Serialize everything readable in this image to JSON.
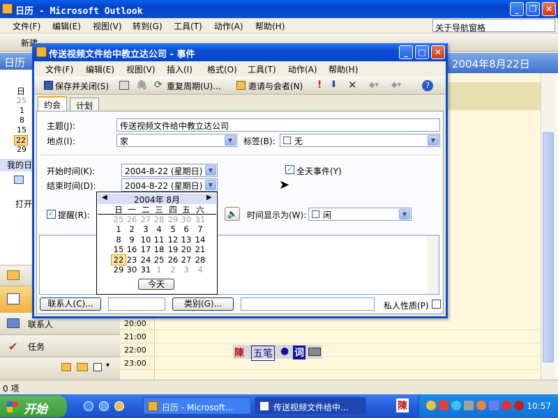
{
  "outlook": {
    "title": "日历 - Microsoft Outlook",
    "menu": [
      "文件(F)",
      "编辑(E)",
      "视图(V)",
      "转到(G)",
      "工具(T)",
      "动作(A)",
      "帮助(H)"
    ],
    "help_box": "关于导航窗格",
    "toolbar_partial": "新建",
    "nav_header": "日历",
    "date_header": "2004年8月22日",
    "mini_cal": {
      "dow": "日",
      "days": [
        "25",
        "1",
        "8",
        "15",
        "22",
        "29"
      ]
    },
    "my_calendar": "我的日",
    "open_label": "打开",
    "contacts_nav": "联系人",
    "tasks_nav": "任务",
    "times": [
      "20:00",
      "21:00",
      "22:00",
      "23:00"
    ],
    "status": "0 项"
  },
  "dialog": {
    "title": "传送视频文件给中教立达公司 - 事件",
    "menu": [
      "文件(F)",
      "编辑(E)",
      "视图(V)",
      "插入(I)",
      "格式(O)",
      "工具(T)",
      "动作(A)",
      "帮助(H)"
    ],
    "toolbar": {
      "save_close": "保存并关闭(S)",
      "recurrence": "重复周期(U)...",
      "invite": "邀请与会者(N)"
    },
    "tabs": [
      "约会",
      "计划"
    ],
    "subject_label": "主题(J):",
    "subject_value": "传送视频文件给中教立达公司",
    "location_label": "地点(I):",
    "location_value": "家",
    "tag_label": "标签(B):",
    "tag_value": "无",
    "start_label": "开始时间(K):",
    "start_value": "2004-8-22 (星期日)",
    "end_label": "结束时间(D):",
    "end_value": "2004-8-22 (星期日)",
    "allday_label": "全天事件(Y)",
    "allday_checked": true,
    "reminder_label": "提醒(R):",
    "reminder_checked": true,
    "show_as_label": "时间显示为(W):",
    "show_as_value": "闲",
    "contacts_button": "联系人(C)...",
    "category_button": "类别(G)...",
    "private_label": "私人性质(P)"
  },
  "date_picker": {
    "month": "2004年 8月",
    "weekdays": [
      "日",
      "一",
      "二",
      "三",
      "四",
      "五",
      "六"
    ],
    "weeks": [
      [
        "25",
        "26",
        "27",
        "28",
        "29",
        "30",
        "31"
      ],
      [
        "1",
        "2",
        "3",
        "4",
        "5",
        "6",
        "7"
      ],
      [
        "8",
        "9",
        "10",
        "11",
        "12",
        "13",
        "14"
      ],
      [
        "15",
        "16",
        "17",
        "18",
        "19",
        "20",
        "21"
      ],
      [
        "22",
        "23",
        "24",
        "25",
        "26",
        "27",
        "28"
      ],
      [
        "29",
        "30",
        "31",
        "1",
        "2",
        "3",
        "4"
      ]
    ],
    "selected": "22",
    "today_button": "今天"
  },
  "ime": {
    "a": "陳",
    "b": "五笔",
    "c": "●",
    "d": "词"
  },
  "taskbar": {
    "start": "开始",
    "tasks": [
      "日历 - Microsoft...",
      "传送视频文件给中..."
    ],
    "tray_char": "陳",
    "clock": "10:57"
  }
}
